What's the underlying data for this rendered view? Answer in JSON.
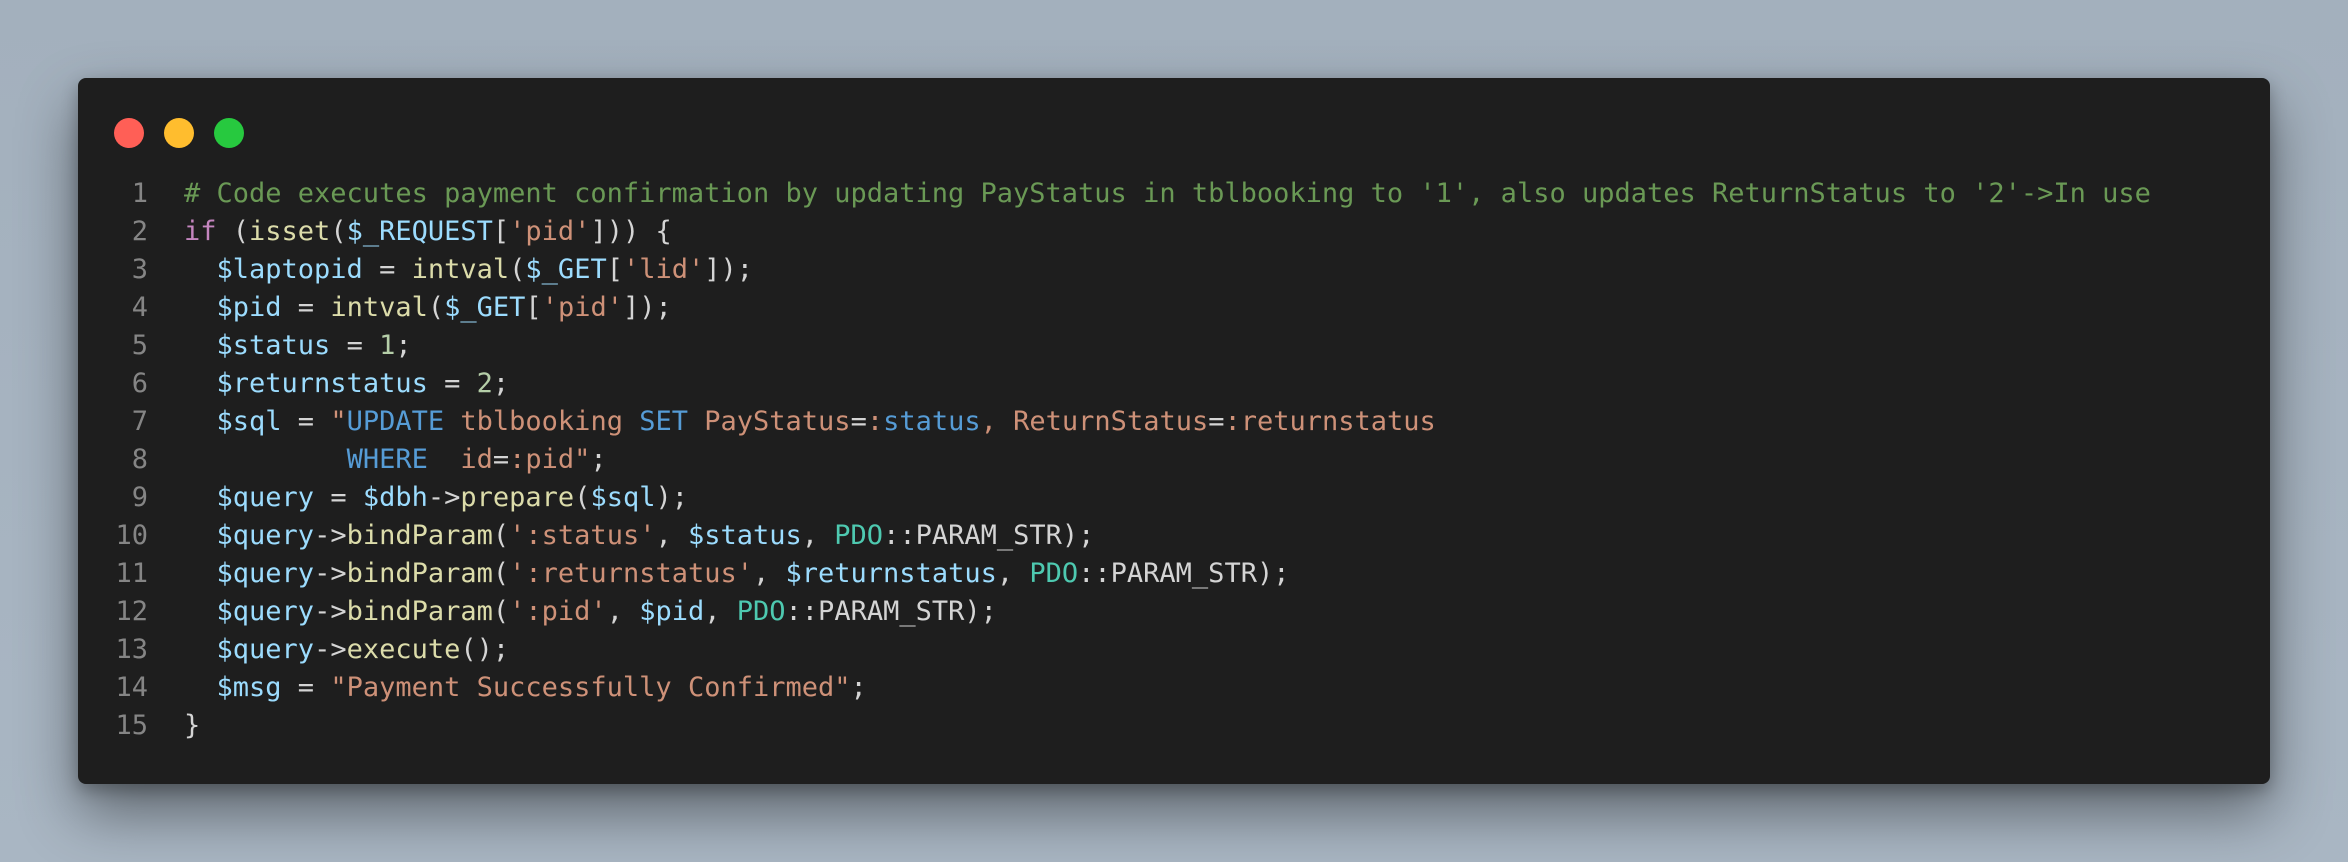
{
  "window": {
    "traffic_lights": [
      "close",
      "minimize",
      "maximize"
    ],
    "colors": {
      "background": "#1e1e1e",
      "close": "#ff5f56",
      "minimize": "#ffbd2e",
      "maximize": "#27c93f"
    }
  },
  "code": {
    "language": "php",
    "lines": [
      {
        "n": "1",
        "tokens": [
          {
            "t": "comment",
            "v": "# Code executes payment confirmation by updating PayStatus in tblbooking to '1', also updates ReturnStatus to '2'->In use"
          }
        ]
      },
      {
        "n": "2",
        "tokens": [
          {
            "t": "kw",
            "v": "if"
          },
          {
            "t": "op",
            "v": " ("
          },
          {
            "t": "fn",
            "v": "isset"
          },
          {
            "t": "op",
            "v": "("
          },
          {
            "t": "var",
            "v": "$_REQUEST"
          },
          {
            "t": "op",
            "v": "["
          },
          {
            "t": "str",
            "v": "'pid'"
          },
          {
            "t": "op",
            "v": "])) {"
          }
        ]
      },
      {
        "n": "3",
        "tokens": [
          {
            "t": "op",
            "v": "  "
          },
          {
            "t": "var",
            "v": "$laptopid"
          },
          {
            "t": "op",
            "v": " = "
          },
          {
            "t": "fn",
            "v": "intval"
          },
          {
            "t": "op",
            "v": "("
          },
          {
            "t": "var",
            "v": "$_GET"
          },
          {
            "t": "op",
            "v": "["
          },
          {
            "t": "str",
            "v": "'lid'"
          },
          {
            "t": "op",
            "v": "]);"
          }
        ]
      },
      {
        "n": "4",
        "tokens": [
          {
            "t": "op",
            "v": "  "
          },
          {
            "t": "var",
            "v": "$pid"
          },
          {
            "t": "op",
            "v": " = "
          },
          {
            "t": "fn",
            "v": "intval"
          },
          {
            "t": "op",
            "v": "("
          },
          {
            "t": "var",
            "v": "$_GET"
          },
          {
            "t": "op",
            "v": "["
          },
          {
            "t": "str",
            "v": "'pid'"
          },
          {
            "t": "op",
            "v": "]);"
          }
        ]
      },
      {
        "n": "5",
        "tokens": [
          {
            "t": "op",
            "v": "  "
          },
          {
            "t": "var",
            "v": "$status"
          },
          {
            "t": "op",
            "v": " = "
          },
          {
            "t": "num",
            "v": "1"
          },
          {
            "t": "op",
            "v": ";"
          }
        ]
      },
      {
        "n": "6",
        "tokens": [
          {
            "t": "op",
            "v": "  "
          },
          {
            "t": "var",
            "v": "$returnstatus"
          },
          {
            "t": "op",
            "v": " = "
          },
          {
            "t": "num",
            "v": "2"
          },
          {
            "t": "op",
            "v": ";"
          }
        ]
      },
      {
        "n": "7",
        "tokens": [
          {
            "t": "op",
            "v": "  "
          },
          {
            "t": "var",
            "v": "$sql"
          },
          {
            "t": "op",
            "v": " = "
          },
          {
            "t": "str",
            "v": "\""
          },
          {
            "t": "sql",
            "v": "UPDATE"
          },
          {
            "t": "str",
            "v": " tblbooking "
          },
          {
            "t": "sql",
            "v": "SET"
          },
          {
            "t": "str",
            "v": " PayStatus"
          },
          {
            "t": "op",
            "v": "="
          },
          {
            "t": "str",
            "v": ":"
          },
          {
            "t": "sql",
            "v": "status"
          },
          {
            "t": "str",
            "v": ", ReturnStatus"
          },
          {
            "t": "op",
            "v": "="
          },
          {
            "t": "str",
            "v": ":returnstatus"
          }
        ]
      },
      {
        "n": "8",
        "tokens": [
          {
            "t": "op",
            "v": "          "
          },
          {
            "t": "sql",
            "v": "WHERE"
          },
          {
            "t": "str",
            "v": "  id"
          },
          {
            "t": "op",
            "v": "="
          },
          {
            "t": "str",
            "v": ":pid\""
          },
          {
            "t": "op",
            "v": ";"
          }
        ]
      },
      {
        "n": "9",
        "tokens": [
          {
            "t": "op",
            "v": "  "
          },
          {
            "t": "var",
            "v": "$query"
          },
          {
            "t": "op",
            "v": " = "
          },
          {
            "t": "var",
            "v": "$dbh"
          },
          {
            "t": "op",
            "v": "->"
          },
          {
            "t": "fn",
            "v": "prepare"
          },
          {
            "t": "op",
            "v": "("
          },
          {
            "t": "var",
            "v": "$sql"
          },
          {
            "t": "op",
            "v": ");"
          }
        ]
      },
      {
        "n": "10",
        "tokens": [
          {
            "t": "op",
            "v": "  "
          },
          {
            "t": "var",
            "v": "$query"
          },
          {
            "t": "op",
            "v": "->"
          },
          {
            "t": "fn",
            "v": "bindParam"
          },
          {
            "t": "op",
            "v": "("
          },
          {
            "t": "str",
            "v": "':status'"
          },
          {
            "t": "op",
            "v": ", "
          },
          {
            "t": "var",
            "v": "$status"
          },
          {
            "t": "op",
            "v": ", "
          },
          {
            "t": "cls",
            "v": "PDO"
          },
          {
            "t": "op",
            "v": "::PARAM_STR);"
          }
        ]
      },
      {
        "n": "11",
        "tokens": [
          {
            "t": "op",
            "v": "  "
          },
          {
            "t": "var",
            "v": "$query"
          },
          {
            "t": "op",
            "v": "->"
          },
          {
            "t": "fn",
            "v": "bindParam"
          },
          {
            "t": "op",
            "v": "("
          },
          {
            "t": "str",
            "v": "':returnstatus'"
          },
          {
            "t": "op",
            "v": ", "
          },
          {
            "t": "var",
            "v": "$returnstatus"
          },
          {
            "t": "op",
            "v": ", "
          },
          {
            "t": "cls",
            "v": "PDO"
          },
          {
            "t": "op",
            "v": "::PARAM_STR);"
          }
        ]
      },
      {
        "n": "12",
        "tokens": [
          {
            "t": "op",
            "v": "  "
          },
          {
            "t": "var",
            "v": "$query"
          },
          {
            "t": "op",
            "v": "->"
          },
          {
            "t": "fn",
            "v": "bindParam"
          },
          {
            "t": "op",
            "v": "("
          },
          {
            "t": "str",
            "v": "':pid'"
          },
          {
            "t": "op",
            "v": ", "
          },
          {
            "t": "var",
            "v": "$pid"
          },
          {
            "t": "op",
            "v": ", "
          },
          {
            "t": "cls",
            "v": "PDO"
          },
          {
            "t": "op",
            "v": "::PARAM_STR);"
          }
        ]
      },
      {
        "n": "13",
        "tokens": [
          {
            "t": "op",
            "v": "  "
          },
          {
            "t": "var",
            "v": "$query"
          },
          {
            "t": "op",
            "v": "->"
          },
          {
            "t": "fn",
            "v": "execute"
          },
          {
            "t": "op",
            "v": "();"
          }
        ]
      },
      {
        "n": "14",
        "tokens": [
          {
            "t": "op",
            "v": "  "
          },
          {
            "t": "var",
            "v": "$msg"
          },
          {
            "t": "op",
            "v": " = "
          },
          {
            "t": "str",
            "v": "\"Payment Successfully Confirmed\""
          },
          {
            "t": "op",
            "v": ";"
          }
        ]
      },
      {
        "n": "15",
        "tokens": [
          {
            "t": "op",
            "v": "}"
          }
        ]
      }
    ]
  }
}
